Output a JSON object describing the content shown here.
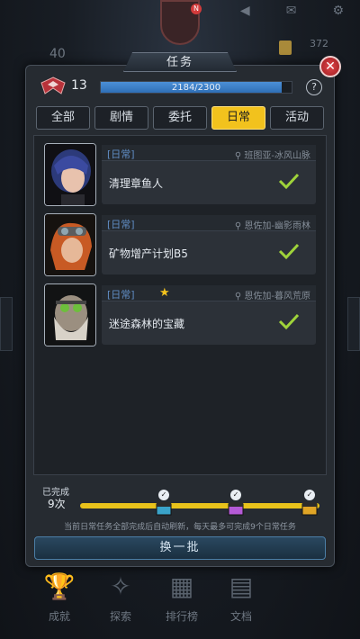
{
  "background": {
    "left_count": "40",
    "right_count": "372",
    "avatar_badge": "N"
  },
  "header": {
    "title": "任务",
    "close_label": "✕",
    "help_label": "?"
  },
  "rank": {
    "level": "13",
    "xp_text": "2184/2300",
    "xp_progress": 0.9496
  },
  "tabs": [
    {
      "label": "全部",
      "active": false
    },
    {
      "label": "剧情",
      "active": false
    },
    {
      "label": "委托",
      "active": false
    },
    {
      "label": "日常",
      "active": true
    },
    {
      "label": "活动",
      "active": false
    }
  ],
  "quests": [
    {
      "category": "[日常]",
      "location": "班图亚-冰风山脉",
      "name": "清理章鱼人",
      "completed": true,
      "starred": false
    },
    {
      "category": "[日常]",
      "location": "恩佐加-幽影雨林",
      "name": "矿物增产计划B5",
      "completed": true,
      "starred": false
    },
    {
      "category": "[日常]",
      "location": "恩佐加-暮风荒原",
      "name": "迷途森林的宝藏",
      "completed": true,
      "starred": true
    }
  ],
  "progress": {
    "completed_label": "已完成",
    "completed_count": "9次",
    "milestones_claimed": 3
  },
  "hint": "当前日常任务全部完成后自动刷新，每天最多可完成9个日常任务",
  "refresh_button": "换一批",
  "bottom_nav": [
    "成就",
    "探索",
    "排行榜",
    "文档"
  ],
  "colors": {
    "accent": "#f2c21d",
    "category": "#5f8cc3",
    "check": "#9fd33a",
    "xp": "#3f82cc"
  }
}
